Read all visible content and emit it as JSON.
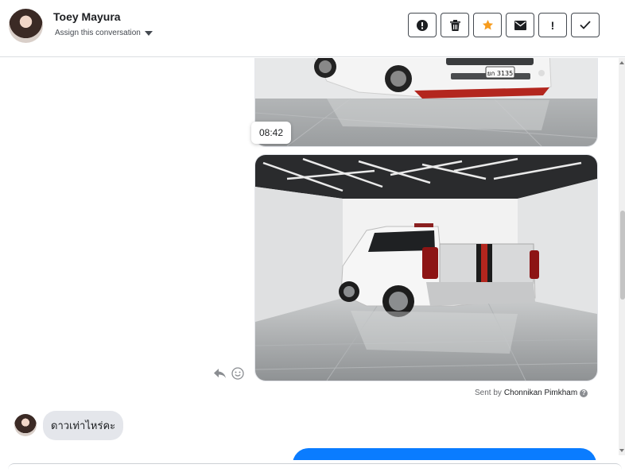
{
  "header": {
    "contact_name": "Toey Mayura",
    "assign_label": "Assign this conversation"
  },
  "toolbar": {
    "buttons": [
      {
        "name": "report-spam",
        "icon": "exclamation-circle-icon"
      },
      {
        "name": "delete",
        "icon": "trash-icon"
      },
      {
        "name": "star",
        "icon": "star-icon",
        "color": "#f79c1e"
      },
      {
        "name": "mark-unread",
        "icon": "envelope-icon"
      },
      {
        "name": "follow-up",
        "icon": "exclamation-icon",
        "label": "!"
      },
      {
        "name": "mark-done",
        "icon": "check-icon"
      }
    ]
  },
  "conversation": {
    "timestamp": "08:42",
    "sent_by_prefix": "Sent by",
    "sent_by_name": "Chonnikan Pimkham",
    "incoming_message": "ดาวเท่าไหร่คะ"
  },
  "colors": {
    "accent_blue": "#0a7cff",
    "incoming_bubble": "#e4e6eb",
    "star": "#f79c1e"
  },
  "photo_plates": {
    "plate_text": "ยก 3135"
  }
}
